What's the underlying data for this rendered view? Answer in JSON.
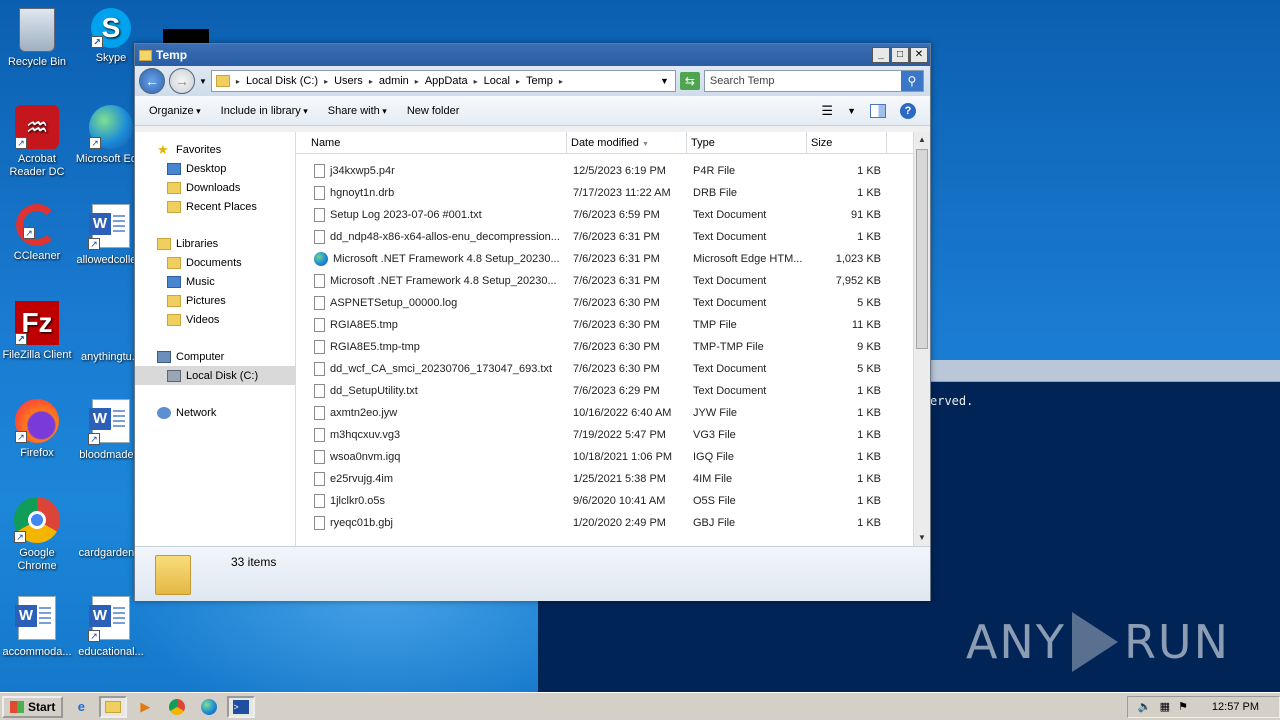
{
  "desktop": {
    "icons": [
      {
        "label": "Recycle Bin"
      },
      {
        "label": "Skype"
      },
      {
        "label": "Acrobat Reader DC"
      },
      {
        "label": "Microsoft Ed..."
      },
      {
        "label": "CCleaner"
      },
      {
        "label": "allowedcolle..."
      },
      {
        "label": "FileZilla Client"
      },
      {
        "label": "anythingtu..."
      },
      {
        "label": "Firefox"
      },
      {
        "label": "bloodmade..."
      },
      {
        "label": "Google Chrome"
      },
      {
        "label": "cardgarden..."
      },
      {
        "label": "accommoda..."
      },
      {
        "label": "educational..."
      }
    ]
  },
  "console": {
    "text": "erved."
  },
  "watermark": {
    "left": "ANY",
    "right": "RUN"
  },
  "explorer": {
    "title": "Temp",
    "breadcrumb": [
      "Local Disk (C:)",
      "Users",
      "admin",
      "AppData",
      "Local",
      "Temp"
    ],
    "search_placeholder": "Search Temp",
    "toolbar": {
      "organize": "Organize",
      "include": "Include in library",
      "share": "Share with",
      "new_folder": "New folder"
    },
    "nav": {
      "favorites": "Favorites",
      "desktop": "Desktop",
      "downloads": "Downloads",
      "recent": "Recent Places",
      "libraries": "Libraries",
      "documents": "Documents",
      "music": "Music",
      "pictures": "Pictures",
      "videos": "Videos",
      "computer": "Computer",
      "local_disk": "Local Disk (C:)",
      "network": "Network"
    },
    "columns": {
      "name": "Name",
      "date": "Date modified",
      "type": "Type",
      "size": "Size"
    },
    "files": [
      {
        "name": "j34kxwp5.p4r",
        "date": "12/5/2023 6:19 PM",
        "type": "P4R File",
        "size": "1 KB",
        "icon": "file"
      },
      {
        "name": "hgnoyt1n.drb",
        "date": "7/17/2023 11:22 AM",
        "type": "DRB File",
        "size": "1 KB",
        "icon": "file"
      },
      {
        "name": "Setup Log 2023-07-06 #001.txt",
        "date": "7/6/2023 6:59 PM",
        "type": "Text Document",
        "size": "91 KB",
        "icon": "file"
      },
      {
        "name": "dd_ndp48-x86-x64-allos-enu_decompression...",
        "date": "7/6/2023 6:31 PM",
        "type": "Text Document",
        "size": "1 KB",
        "icon": "file"
      },
      {
        "name": "Microsoft .NET Framework 4.8 Setup_20230...",
        "date": "7/6/2023 6:31 PM",
        "type": "Microsoft Edge HTM...",
        "size": "1,023 KB",
        "icon": "edge"
      },
      {
        "name": "Microsoft .NET Framework 4.8 Setup_20230...",
        "date": "7/6/2023 6:31 PM",
        "type": "Text Document",
        "size": "7,952 KB",
        "icon": "file"
      },
      {
        "name": "ASPNETSetup_00000.log",
        "date": "7/6/2023 6:30 PM",
        "type": "Text Document",
        "size": "5 KB",
        "icon": "file"
      },
      {
        "name": "RGIA8E5.tmp",
        "date": "7/6/2023 6:30 PM",
        "type": "TMP File",
        "size": "11 KB",
        "icon": "file"
      },
      {
        "name": "RGIA8E5.tmp-tmp",
        "date": "7/6/2023 6:30 PM",
        "type": "TMP-TMP File",
        "size": "9 KB",
        "icon": "file"
      },
      {
        "name": "dd_wcf_CA_smci_20230706_173047_693.txt",
        "date": "7/6/2023 6:30 PM",
        "type": "Text Document",
        "size": "5 KB",
        "icon": "file"
      },
      {
        "name": "dd_SetupUtility.txt",
        "date": "7/6/2023 6:29 PM",
        "type": "Text Document",
        "size": "1 KB",
        "icon": "file"
      },
      {
        "name": "axmtn2eo.jyw",
        "date": "10/16/2022 6:40 AM",
        "type": "JYW File",
        "size": "1 KB",
        "icon": "file"
      },
      {
        "name": "m3hqcxuv.vg3",
        "date": "7/19/2022 5:47 PM",
        "type": "VG3 File",
        "size": "1 KB",
        "icon": "file"
      },
      {
        "name": "wsoa0nvm.igq",
        "date": "10/18/2021 1:06 PM",
        "type": "IGQ File",
        "size": "1 KB",
        "icon": "file"
      },
      {
        "name": "e25rvujg.4im",
        "date": "1/25/2021 5:38 PM",
        "type": "4IM File",
        "size": "1 KB",
        "icon": "file"
      },
      {
        "name": "1jlclkr0.o5s",
        "date": "9/6/2020 10:41 AM",
        "type": "O5S File",
        "size": "1 KB",
        "icon": "file"
      },
      {
        "name": "ryeqc01b.gbj",
        "date": "1/20/2020 2:49 PM",
        "type": "GBJ File",
        "size": "1 KB",
        "icon": "file"
      }
    ],
    "status": "33 items"
  },
  "taskbar": {
    "start": "Start",
    "clock": "12:57 PM"
  }
}
